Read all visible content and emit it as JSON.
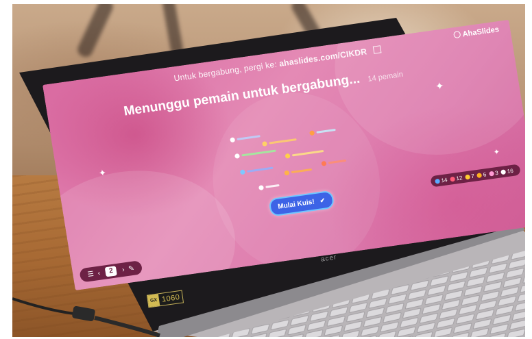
{
  "screen": {
    "join_prefix": "Untuk bergabung, pergi ke:",
    "join_url": "ahaslides.com/CIKDR",
    "brand": "AhaSlides",
    "heading": "Menunggu pemain untuk bergabung...",
    "player_count": "14 pemain",
    "start_button": "Mulai Kuis!",
    "page_number": "2",
    "reactions": [
      "14",
      "12",
      "7",
      "6",
      "3",
      "16"
    ]
  },
  "laptop": {
    "brand_logo": "acer",
    "sticker_badge": "GX",
    "sticker_model": "1060"
  },
  "colors": {
    "screen_pink": "#dc79ac",
    "button_blue": "#3d63e6",
    "toolbar_plum": "#6d2145",
    "table_wood": "#a86a34"
  },
  "icons": [
    "qr-icon",
    "sparkle-icon",
    "checkmark-icon",
    "menu-icon",
    "chevron-left-icon",
    "chevron-right-icon",
    "pen-icon",
    "heart-icon"
  ]
}
